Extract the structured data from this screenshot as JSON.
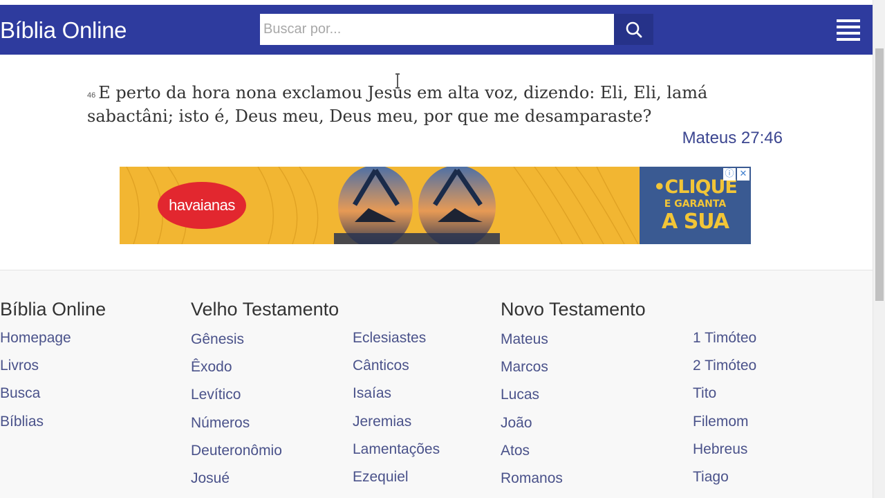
{
  "header": {
    "brand": "Bíblia Online",
    "search_placeholder": "Buscar por...",
    "search_icon": "search-icon",
    "menu_icon": "hamburger-menu-icon"
  },
  "verse": {
    "number": "46",
    "text": "E perto da hora nona exclamou Jesus em alta voz, dizendo: Eli, Eli, lamá sabactâni; isto é, Deus meu, Deus meu, por que me desamparaste?",
    "reference": "Mateus 27:46"
  },
  "ad": {
    "logo_text": "havaianas",
    "cta_line1": "•CLIQUE",
    "cta_line2": "E GARANTA",
    "cta_line3": "A SUA",
    "info_icon": "ⓘ",
    "close_icon": "✕",
    "colors": {
      "background": "#f2b632",
      "logo": "#e2272f",
      "panel": "#3a5a92"
    }
  },
  "footer": {
    "site": {
      "title": "Bíblia Online",
      "links": [
        "Homepage",
        "Livros",
        "Busca",
        "Bíblias"
      ]
    },
    "old_testament": {
      "title": "Velho Testamento",
      "col1": [
        "Gênesis",
        "Êxodo",
        "Levítico",
        "Números",
        "Deuteronômio",
        "Josué"
      ],
      "col2": [
        "Eclesiastes",
        "Cânticos",
        "Isaías",
        "Jeremias",
        "Lamentações",
        "Ezequiel"
      ]
    },
    "new_testament": {
      "title": "Novo Testamento",
      "col1": [
        "Mateus",
        "Marcos",
        "Lucas",
        "João",
        "Atos",
        "Romanos"
      ],
      "col2": [
        "1 Timóteo",
        "2 Timóteo",
        "Tito",
        "Filemom",
        "Hebreus",
        "Tiago"
      ]
    }
  },
  "colors": {
    "header": "#2e3b9e",
    "search_button": "#263289",
    "link": "#4a528a",
    "reference": "#3b4590"
  }
}
